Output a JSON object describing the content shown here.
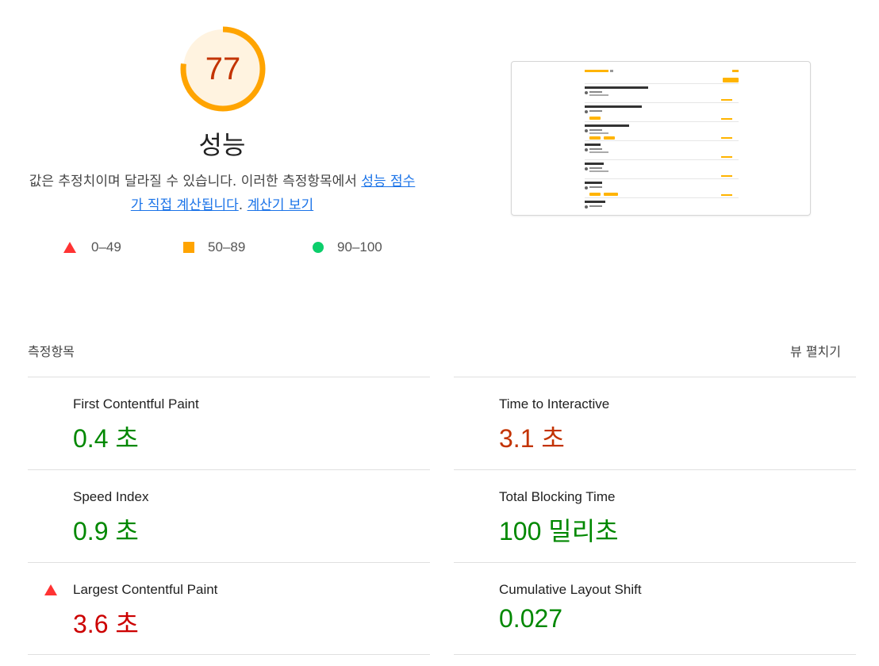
{
  "score": {
    "value": "77",
    "fraction": 0.77,
    "title": "성능",
    "ring_color": "#ffa400",
    "ring_bg": "#fff3e0",
    "text_color": "#c33300"
  },
  "description": {
    "text": "값은 추정치이며 달라질 수 있습니다. 이러한 측정항목에서 ",
    "link1": "성능 점수가 직접 계산됩니다",
    "period": ". ",
    "link2": "계산기 보기"
  },
  "legend": [
    {
      "label": "0–49",
      "shape": "triangle-icon",
      "color": "#ff3333"
    },
    {
      "label": "50–89",
      "shape": "square-icon",
      "color": "#ffa400"
    },
    {
      "label": "90–100",
      "shape": "circle-icon",
      "color": "#0cce6b"
    }
  ],
  "metrics_header": {
    "label": "측정항목",
    "expand": "뷰 펼치기"
  },
  "metrics": [
    {
      "title": "First Contentful Paint",
      "value": "0.4 초",
      "rating": "pass"
    },
    {
      "title": "Time to Interactive",
      "value": "3.1 초",
      "rating": "average"
    },
    {
      "title": "Speed Index",
      "value": "0.9 초",
      "rating": "pass"
    },
    {
      "title": "Total Blocking Time",
      "value": "100 밀리초",
      "rating": "pass"
    },
    {
      "title": "Largest Contentful Paint",
      "value": "3.6 초",
      "rating": "fail"
    },
    {
      "title": "Cumulative Layout Shift",
      "value": "0.027",
      "rating": "pass"
    }
  ],
  "colors": {
    "pass": "#008800",
    "average": "#c33300",
    "fail": "#cc0000",
    "link": "#1a73e8"
  }
}
